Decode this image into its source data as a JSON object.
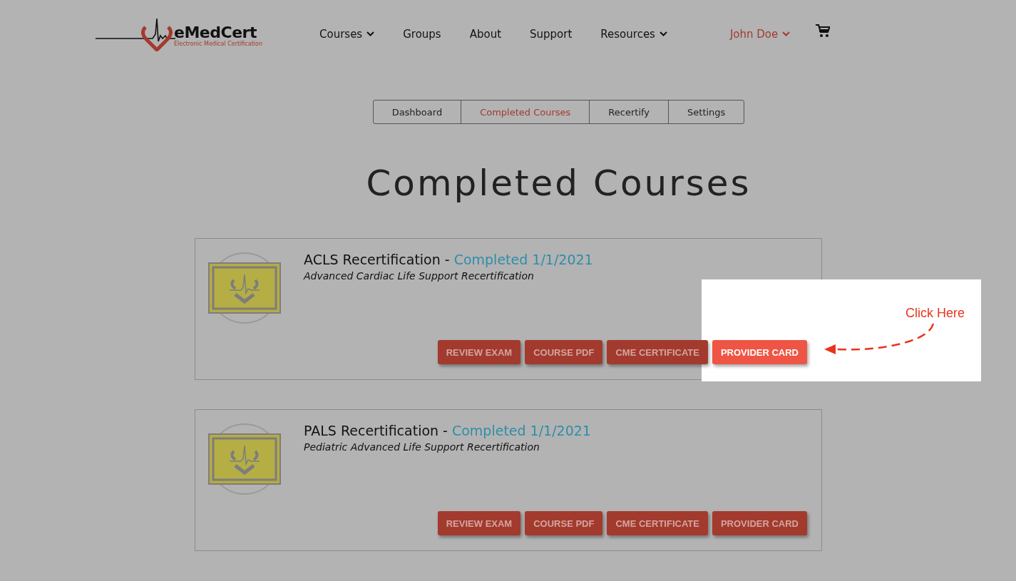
{
  "logo": {
    "name": "eMedCert",
    "tagline": "Electronic Medical Certification"
  },
  "nav": [
    {
      "label": "Courses",
      "has_menu": true
    },
    {
      "label": "Groups",
      "has_menu": false
    },
    {
      "label": "About",
      "has_menu": false
    },
    {
      "label": "Support",
      "has_menu": false
    },
    {
      "label": "Resources",
      "has_menu": true
    }
  ],
  "user": {
    "name": "John Doe",
    "has_menu": true
  },
  "tabs": [
    {
      "label": "Dashboard",
      "selected": false
    },
    {
      "label": "Completed Courses",
      "selected": true
    },
    {
      "label": "Recertify",
      "selected": false
    },
    {
      "label": "Settings",
      "selected": false
    }
  ],
  "page_title": "Completed Courses",
  "courses": [
    {
      "title": "ACLS Recertification",
      "separator": "-",
      "status": "Completed 1/1/2021",
      "subtitle": "Advanced Cardiac Life Support Recertification",
      "callout": "Click Here",
      "buttons": [
        {
          "label": "REVIEW EXAM",
          "highlighted": false
        },
        {
          "label": "COURSE PDF",
          "highlighted": false
        },
        {
          "label": "CME CERTIFICATE",
          "highlighted": false
        },
        {
          "label": "PROVIDER CARD",
          "highlighted": true
        }
      ]
    },
    {
      "title": "PALS Recertification",
      "separator": "-",
      "status": "Completed 1/1/2021",
      "subtitle": "Pediatric Advanced Life Support Recertification",
      "buttons": [
        {
          "label": "REVIEW EXAM",
          "highlighted": false
        },
        {
          "label": "COURSE PDF",
          "highlighted": false
        },
        {
          "label": "CME CERTIFICATE",
          "highlighted": false
        },
        {
          "label": "PROVIDER CARD",
          "highlighted": false
        }
      ]
    }
  ]
}
